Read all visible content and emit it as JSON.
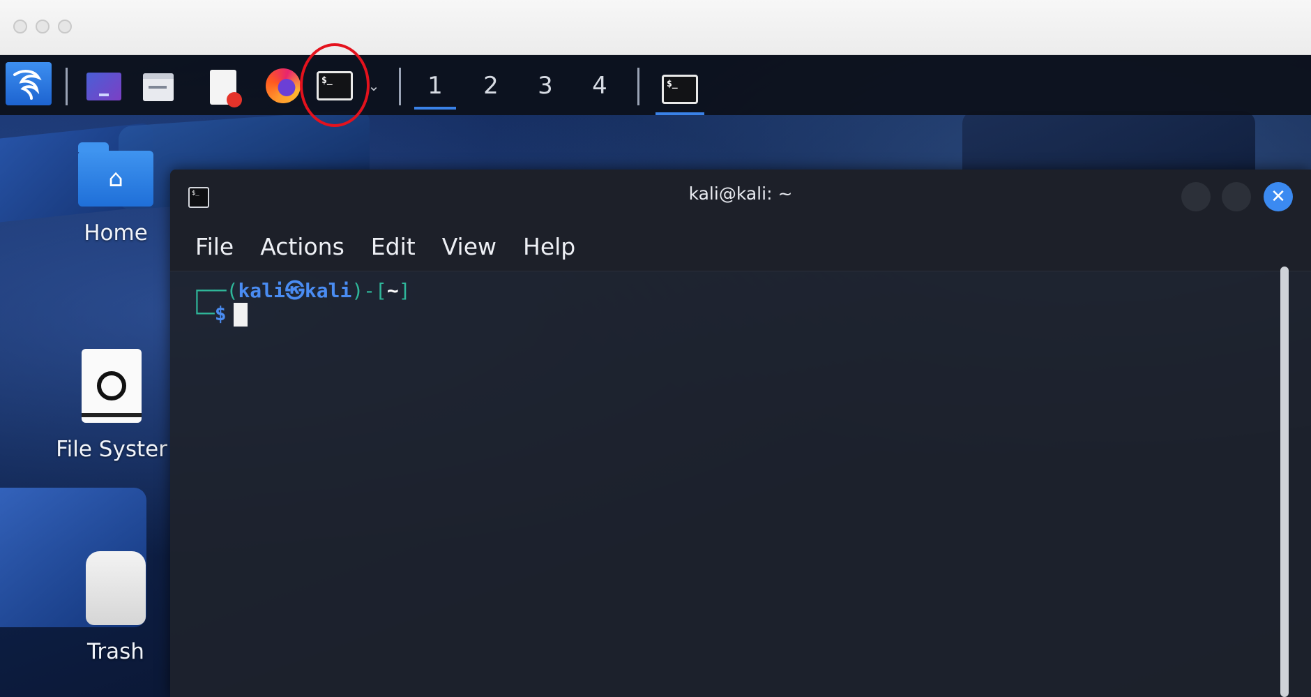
{
  "host_window": {
    "buttons": [
      "close",
      "minimize",
      "zoom"
    ]
  },
  "taskbar": {
    "app_menu_icon": "kali-dragon-icon",
    "launchers": [
      {
        "name": "show-desktop",
        "icon": "desktop-icon"
      },
      {
        "name": "file-manager",
        "icon": "folder-icon"
      },
      {
        "name": "text-editor",
        "icon": "document-icon"
      },
      {
        "name": "firefox",
        "icon": "firefox-icon"
      },
      {
        "name": "terminal",
        "icon": "terminal-icon",
        "label": "$_"
      }
    ],
    "workspaces": [
      "1",
      "2",
      "3",
      "4"
    ],
    "active_workspace": "1",
    "running_task_label": "$_"
  },
  "desktop_icons": [
    {
      "label": "Home",
      "icon": "home-folder-icon"
    },
    {
      "label": "File Syster",
      "icon": "drive-icon"
    },
    {
      "label": "Trash",
      "icon": "trash-icon"
    }
  ],
  "terminal": {
    "title": "kali@kali: ~",
    "icon_label": "$_",
    "menu": [
      "File",
      "Actions",
      "Edit",
      "View",
      "Help"
    ],
    "prompt": {
      "corner_top": "┌──",
      "open_paren": "(",
      "user_host": "kali㉿kali",
      "close_paren": ")-[",
      "path": "~",
      "close_bracket": "]",
      "corner_bottom": "└─",
      "symbol": "$"
    }
  },
  "annotation_color": "#e4121d",
  "accent_color": "#3a82e8"
}
